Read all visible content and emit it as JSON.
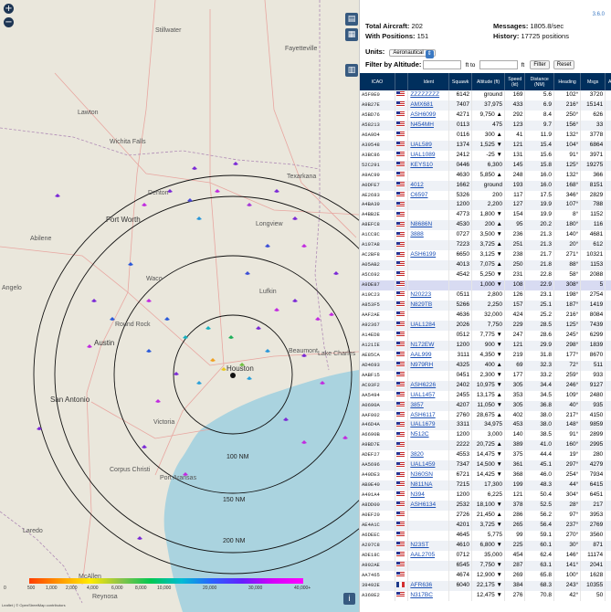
{
  "map": {
    "zoom_in": "+",
    "zoom_out": "−",
    "ring_labels": [
      "100 NM",
      "150 NM",
      "200 NM"
    ],
    "cities": [
      "Stillwater",
      "Fayetteville",
      "Lawton",
      "Wichita Falls",
      "Texarkana",
      "Denton",
      "Fort Worth",
      "Longview",
      "Abilene",
      "Waco",
      "Lufkin",
      "Round Rock",
      "Austin",
      "Houston",
      "Beaumont",
      "Lake Charles",
      "San Antonio",
      "Victoria",
      "Corpus Christi",
      "Port Aransas",
      "Laredo",
      "McAllen",
      "Reynosa",
      "Angelo"
    ],
    "altitude_ticks": [
      "0",
      "500",
      "1,000",
      "2,000",
      "4,000",
      "6,000",
      "8,000",
      "10,000",
      "20,000",
      "30,000",
      "40,000+"
    ],
    "altitude_unit": "ft",
    "info_btn": "i",
    "credits": "Leaflet | © OpenStreetMap contributors"
  },
  "panel": {
    "version": "3.6.0",
    "total_label": "Total Aircraft:",
    "total_value": "202",
    "positions_label": "With Positions:",
    "positions_value": "151",
    "messages_label": "Messages:",
    "messages_value": "1805.8/sec",
    "history_label": "History:",
    "history_value": "17725 positions",
    "units_label": "Units:",
    "units_value": "Aeronautical",
    "filter_label": "Filter by Altitude:",
    "ft_to": "ft to",
    "ft": "ft",
    "filter_btn": "Filter",
    "reset_btn": "Reset"
  },
  "columns": [
    "ICAO",
    "",
    "Ident",
    "Squawk",
    "Altitude (ft)",
    "Speed (kt)",
    "Distance (NM)",
    "Heading",
    "Msgs",
    "Age"
  ],
  "rows": [
    [
      "A5F9E0",
      "us",
      "ZZZZZZZZ",
      "6142",
      "ground",
      "169",
      "5.6",
      "102°",
      "3720",
      "2"
    ],
    [
      "A9B27E",
      "us",
      "AMX681",
      "7407",
      "37,975",
      "433",
      "6.9",
      "216°",
      "15141",
      ""
    ],
    [
      "A5BD76",
      "us",
      "ASH6099",
      "4271",
      "9,750 ▲",
      "292",
      "8.4",
      "250°",
      "626",
      ""
    ],
    [
      "A58213",
      "us",
      "N454MH",
      "0113",
      "475",
      "123",
      "9.7",
      "156°",
      "33",
      "3"
    ],
    [
      "A6A9D4",
      "us",
      "",
      "0116",
      "300 ▲",
      "41",
      "11.9",
      "132°",
      "3778",
      ""
    ],
    [
      "A39548",
      "us",
      "UAL589",
      "1374",
      "1,525 ▼",
      "121",
      "15.4",
      "104°",
      "6864",
      ""
    ],
    [
      "A3BC86",
      "us",
      "UAL1089",
      "2412",
      "-25 ▼",
      "131",
      "15.6",
      "91°",
      "3971",
      ""
    ],
    [
      "52C291",
      "us",
      "KEYS10",
      "0446",
      "6,300",
      "145",
      "15.8",
      "125°",
      "19275",
      ""
    ],
    [
      "A9AC99",
      "us",
      "",
      "4630",
      "5,850 ▲",
      "248",
      "16.0",
      "132°",
      "366",
      ""
    ],
    [
      "A0DFE7",
      "us",
      "4012",
      "1662",
      "ground",
      "193",
      "16.0",
      "168°",
      "8151",
      ""
    ],
    [
      "AE2683",
      "us",
      "C6597",
      "5326",
      "200",
      "117",
      "17.5",
      "346°",
      "2829",
      ""
    ],
    [
      "A4BA39",
      "us",
      "",
      "1200",
      "2,200",
      "127",
      "19.9",
      "107°",
      "788",
      ""
    ],
    [
      "A4BB2E",
      "us",
      "",
      "4773",
      "1,800 ▼",
      "154",
      "19.9",
      "8°",
      "1152",
      ""
    ],
    [
      "A8EFC8",
      "us",
      "N8686N",
      "4530",
      "200 ▲",
      "95",
      "20.2",
      "180°",
      "116",
      ""
    ],
    [
      "A1CC8C",
      "us",
      "3888",
      "0727",
      "3,500 ▼",
      "236",
      "21.3",
      "140°",
      "4681",
      ""
    ],
    [
      "A107A8",
      "us",
      "",
      "7223",
      "3,725 ▲",
      "251",
      "21.3",
      "20°",
      "612",
      ""
    ],
    [
      "AC2BF8",
      "us",
      "ASH6199",
      "6650",
      "3,125 ▼",
      "238",
      "21.7",
      "271°",
      "10321",
      ""
    ],
    [
      "A05AB2",
      "us",
      "",
      "4013",
      "7,075 ▲",
      "250",
      "21.8",
      "88°",
      "1153",
      ""
    ],
    [
      "A5C692",
      "us",
      "",
      "4542",
      "5,250 ▼",
      "231",
      "22.8",
      "58°",
      "2088",
      ""
    ],
    [
      "A9DE87",
      "us",
      "",
      "",
      "1,000 ▼",
      "108",
      "22.9",
      "308°",
      "5",
      "3"
    ],
    [
      "A19C23",
      "us",
      "N20223",
      "0511",
      "2,800",
      "126",
      "23.1",
      "198°",
      "2754",
      ""
    ],
    [
      "A853F5",
      "us",
      "N829TB",
      "5266",
      "2,250",
      "157",
      "25.1",
      "187°",
      "1419",
      ""
    ],
    [
      "AAF2AE",
      "us",
      "",
      "4636",
      "32,000",
      "424",
      "25.2",
      "216°",
      "8084",
      ""
    ],
    [
      "A92367",
      "us",
      "UAL1284",
      "2026",
      "7,750",
      "229",
      "28.5",
      "125°",
      "7439",
      ""
    ],
    [
      "A14ED8",
      "us",
      "",
      "0512",
      "7,775 ▼",
      "247",
      "28.6",
      "245°",
      "6299",
      ""
    ],
    [
      "A121IE",
      "us",
      "N172EW",
      "1200",
      "900 ▼",
      "121",
      "29.9",
      "298°",
      "1839",
      ""
    ],
    [
      "AE85CA",
      "us",
      "AAL999",
      "3111",
      "4,350 ▼",
      "219",
      "31.8",
      "177°",
      "8670",
      ""
    ],
    [
      "AD4693",
      "us",
      "N979RH",
      "4325",
      "400 ▲",
      "69",
      "32.3",
      "72°",
      "511",
      ""
    ],
    [
      "AABF15",
      "us",
      "",
      "0451",
      "2,300 ▼",
      "177",
      "33.2",
      "259°",
      "933",
      ""
    ],
    [
      "AC03F2",
      "us",
      "ASH6226",
      "2402",
      "10,975 ▼",
      "305",
      "34.4",
      "246°",
      "9127",
      ""
    ],
    [
      "AA5494",
      "us",
      "UAL1457",
      "2455",
      "13,175 ▲",
      "353",
      "34.5",
      "109°",
      "2480",
      ""
    ],
    [
      "A0690A",
      "us",
      "3857",
      "4207",
      "11,050 ▼",
      "305",
      "36.8",
      "40°",
      "935",
      ""
    ],
    [
      "AAF002",
      "us",
      "ASH6117",
      "2760",
      "28,675 ▲",
      "402",
      "38.0",
      "217°",
      "4150",
      ""
    ],
    [
      "A46D4A",
      "us",
      "UAL1679",
      "3311",
      "34,975",
      "453",
      "38.0",
      "148°",
      "9859",
      ""
    ],
    [
      "A6690B",
      "us",
      "N512C",
      "1200",
      "3,000",
      "140",
      "38.5",
      "91°",
      "2899",
      ""
    ],
    [
      "A9BD7E",
      "us",
      "",
      "2222",
      "20,725 ▲",
      "389",
      "41.0",
      "160°",
      "2995",
      ""
    ],
    [
      "ADEF27",
      "us",
      "3820",
      "4553",
      "14,475 ▼",
      "375",
      "44.4",
      "19°",
      "280",
      ""
    ],
    [
      "AA5696",
      "us",
      "UAL1459",
      "7347",
      "14,500 ▼",
      "361",
      "45.1",
      "297°",
      "4279",
      ""
    ],
    [
      "A40DE3",
      "us",
      "N360SN",
      "6721",
      "14,425 ▼",
      "368",
      "46.0",
      "254°",
      "7934",
      ""
    ],
    [
      "AB0E40",
      "us",
      "N811NA",
      "7215",
      "17,300",
      "199",
      "48.3",
      "44°",
      "6415",
      ""
    ],
    [
      "A491A4",
      "us",
      "N394",
      "1200",
      "6,225",
      "121",
      "50.4",
      "304°",
      "6451",
      ""
    ],
    [
      "A8DD00",
      "us",
      "ASH6134",
      "2532",
      "18,100 ▼",
      "378",
      "52.5",
      "28°",
      "217",
      ""
    ],
    [
      "A0EF20",
      "us",
      "",
      "2726",
      "21,450 ▲",
      "286",
      "56.2",
      "97°",
      "3953",
      ""
    ],
    [
      "AE4A1C",
      "us",
      "",
      "4201",
      "3,725 ▼",
      "265",
      "56.4",
      "237°",
      "2769",
      ""
    ],
    [
      "A6DEEC",
      "us",
      "",
      "4645",
      "5,775",
      "99",
      "59.1",
      "270°",
      "3560",
      ""
    ],
    [
      "A207C8",
      "us",
      "N23ST",
      "4610",
      "6,800 ▼",
      "225",
      "60.1",
      "30°",
      "871",
      ""
    ],
    [
      "ADE18C",
      "us",
      "AAL2705",
      "0712",
      "35,000",
      "454",
      "62.4",
      "146°",
      "11174",
      ""
    ],
    [
      "A902AE",
      "us",
      "",
      "6545",
      "7,750 ▼",
      "287",
      "63.1",
      "141°",
      "2041",
      ""
    ],
    [
      "AA7465",
      "us",
      "",
      "4674",
      "12,900 ▼",
      "269",
      "65.8",
      "100°",
      "1628",
      ""
    ],
    [
      "39492E",
      "fr",
      "AFR636",
      "6040",
      "22,175 ▼",
      "384",
      "68.3",
      "243°",
      "10355",
      ""
    ],
    [
      "A360E2",
      "us",
      "N317BC",
      "",
      "12,475 ▼",
      "276",
      "70.8",
      "42°",
      "50",
      "4"
    ]
  ]
}
